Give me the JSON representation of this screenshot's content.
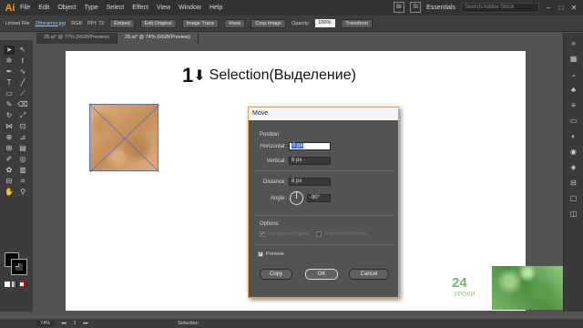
{
  "menubar": {
    "logo": "Ai",
    "items": [
      "File",
      "Edit",
      "Object",
      "Type",
      "Select",
      "Effect",
      "View",
      "Window",
      "Help"
    ],
    "app_icons": [
      "Br",
      "St"
    ],
    "workspace": "Essentials",
    "search_placeholder": "Search Adobe Stock"
  },
  "controlbar": {
    "linked_file": "Linked File",
    "filename": "28mramor.jpg",
    "color_mode": "RGB",
    "ppi": "PPI: 72",
    "embed": "Embed",
    "edit_original": "Edit Original",
    "image_trace": "Image Trace",
    "mask": "Mask",
    "crop_image": "Crop Image",
    "opacity_label": "Opacity:",
    "opacity_value": "100%",
    "transform": "Transform"
  },
  "tabs": [
    {
      "label": "28.ai* @ 77% (RGB/Preview)"
    },
    {
      "label": "28.ai* @ 74% (RGB/Preview)"
    }
  ],
  "heading": {
    "number": "1",
    "arrow": "⬇",
    "text": "Selection(Выделение)"
  },
  "dialog": {
    "title": "Move",
    "position_label": "Position",
    "horizontal_label": "Horizontal:",
    "horizontal_value": "0 px",
    "vertical_label": "Vertical:",
    "vertical_value": "8 px",
    "distance_label": "Distance:",
    "distance_value": "8 px",
    "angle_label": "Angle:",
    "angle_value": "-90°",
    "options_label": "Options",
    "transform_objects": "Transform Objects",
    "transform_patterns": "Transform Patterns",
    "preview_label": "Preview",
    "preview_checked": true,
    "copy_label": "Copy",
    "ok_label": "OK",
    "cancel_label": "Cancel"
  },
  "statusbar": {
    "zoom": "74%",
    "page": "1",
    "tool": "Selection"
  },
  "watermark": {
    "main": "24",
    "sub": "УРОКИ"
  }
}
